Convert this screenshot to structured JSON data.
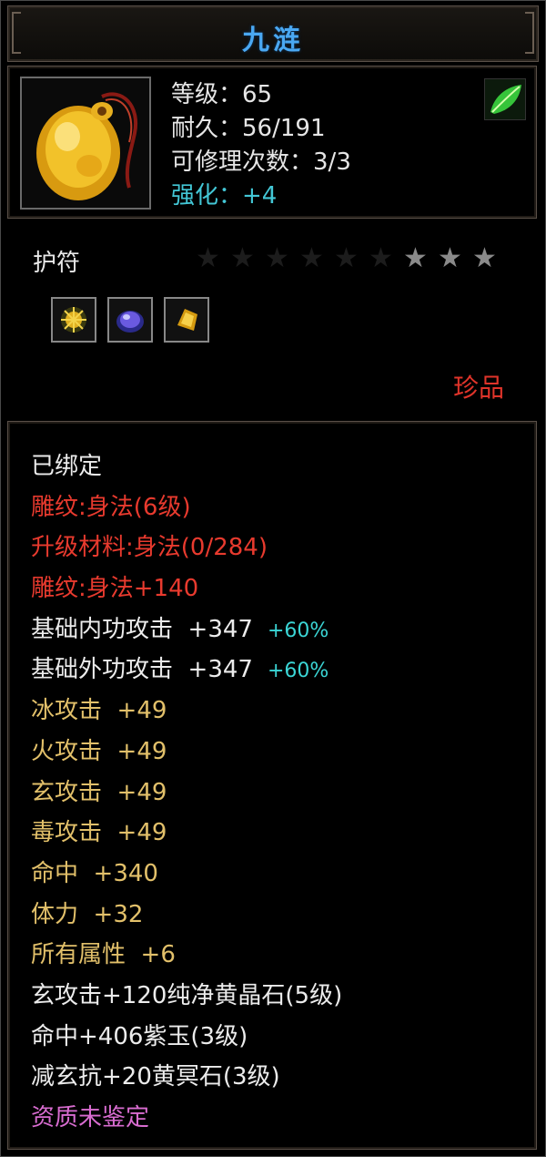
{
  "title": "九涟",
  "icons": {
    "item": "jade-amulet-icon",
    "badge": "green-leaf-icon"
  },
  "stats": {
    "level_label": "等级：",
    "level_value": "65",
    "durability_label": "耐久：",
    "durability_value": "56/191",
    "repairs_label": "可修理次数：",
    "repairs_value": "3/3",
    "enhance_label": "强化：",
    "enhance_value": "+4"
  },
  "type_label": "护符",
  "stars": {
    "total": 9,
    "lit": 3
  },
  "gems": [
    "gold-gem-icon",
    "purple-gem-icon",
    "yellow-gem-icon"
  ],
  "rarity": "珍品",
  "lines": [
    {
      "text": "已绑定",
      "color": "white"
    },
    {
      "text": "雕纹:身法(6级)",
      "color": "red"
    },
    {
      "text": "升级材料:身法(0/284)",
      "color": "red"
    },
    {
      "text": "雕纹:身法+140",
      "color": "red"
    },
    {
      "text": "基础内功攻击  +347",
      "color": "white",
      "pct": "+60%"
    },
    {
      "text": "基础外功攻击  +347",
      "color": "white",
      "pct": "+60%"
    },
    {
      "text": "冰攻击  +49",
      "color": "gold"
    },
    {
      "text": "火攻击  +49",
      "color": "gold"
    },
    {
      "text": "玄攻击  +49",
      "color": "gold"
    },
    {
      "text": "毒攻击  +49",
      "color": "gold"
    },
    {
      "text": "命中  +340",
      "color": "gold"
    },
    {
      "text": "体力  +32",
      "color": "gold"
    },
    {
      "text": "所有属性  +6",
      "color": "gold"
    },
    {
      "text": "玄攻击+120纯净黄晶石(5级)",
      "color": "white"
    },
    {
      "text": "命中+406紫玉(3级)",
      "color": "white"
    },
    {
      "text": "减玄抗+20黄冥石(3级)",
      "color": "white"
    },
    {
      "text": "资质未鉴定",
      "color": "pink"
    }
  ]
}
